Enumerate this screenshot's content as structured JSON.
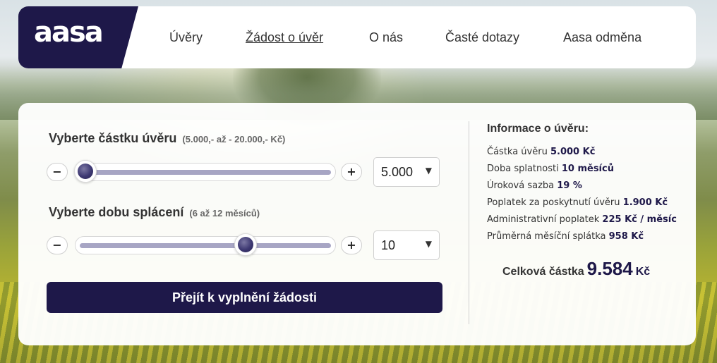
{
  "logo": {
    "text": "aasa"
  },
  "nav": {
    "items": [
      {
        "label": "Úvěry"
      },
      {
        "label": "Žádost o úvěr"
      },
      {
        "label": "O nás"
      },
      {
        "label": "Časté dotazy"
      },
      {
        "label": "Aasa odměna"
      }
    ]
  },
  "amount": {
    "title": "Vyberte částku úvěru",
    "hint": "(5.000,- až - 20.000,- Kč)",
    "minus": "−",
    "plus": "+",
    "selected": "5.000",
    "slider_fraction": 0.0
  },
  "term": {
    "title": "Vyberte dobu splácení",
    "hint": "(6 až 12 měsíců)",
    "minus": "−",
    "plus": "+",
    "selected": "10",
    "slider_fraction": 0.667
  },
  "cta": {
    "label": "Přejít k vyplnění žádosti"
  },
  "info": {
    "title": "Informace o úvěru:",
    "rows": [
      {
        "label": "Částka úvěru",
        "value": "5.000 Kč"
      },
      {
        "label": "Doba splatnosti",
        "value": "10 měsíců"
      },
      {
        "label": "Úroková sazba",
        "value": "19 %"
      },
      {
        "label": "Poplatek za poskytnutí úvěru",
        "value": "1.900 Kč"
      },
      {
        "label": "Administrativní poplatek",
        "value": "225 Kč / měsíc"
      },
      {
        "label": "Průměrná měsíční splátka",
        "value": "958 Kč"
      }
    ],
    "total_label": "Celková částka",
    "total_value": "9.584",
    "total_unit": "Kč"
  },
  "icons": {
    "caret": "chevron-down-icon"
  },
  "colors": {
    "brand": "#1e1849",
    "track": "#a7a5c4"
  }
}
